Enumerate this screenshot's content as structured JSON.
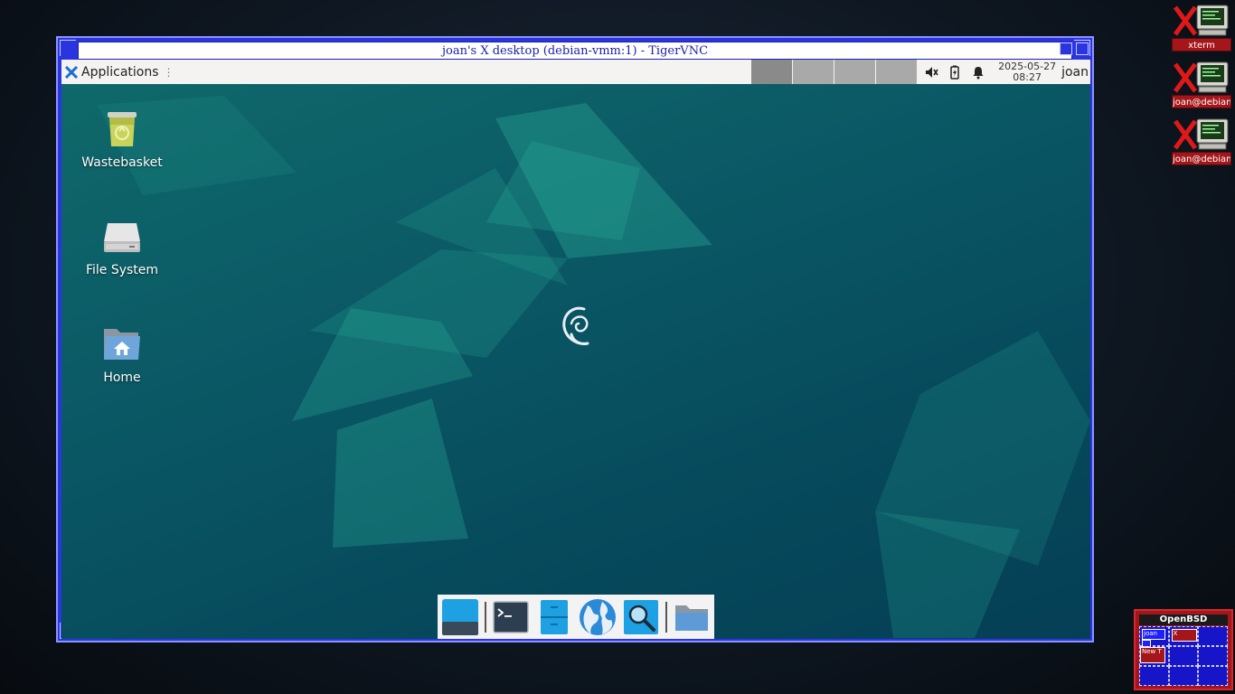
{
  "vnc_window": {
    "title": "joan's X desktop (debian-vmm:1) - TigerVNC"
  },
  "top_panel": {
    "applications_label": "Applications",
    "clock_date": "2025-05-27",
    "clock_time": "08:27",
    "user": "joan",
    "workspace_count": 4,
    "active_workspace": 1
  },
  "desktop_icons": [
    {
      "label": "Wastebasket",
      "icon": "trash-icon"
    },
    {
      "label": "File System",
      "icon": "drive-icon"
    },
    {
      "label": "Home",
      "icon": "home-folder-icon"
    }
  ],
  "dock_items": [
    {
      "name": "show-desktop",
      "icon": "show-desktop-icon"
    },
    {
      "name": "terminal",
      "icon": "terminal-icon"
    },
    {
      "name": "file-manager",
      "icon": "file-cabinet-icon"
    },
    {
      "name": "web-browser",
      "icon": "globe-icon"
    },
    {
      "name": "app-finder",
      "icon": "magnifier-icon"
    },
    {
      "name": "folder",
      "icon": "folder-icon"
    }
  ],
  "host_launchers": [
    {
      "label": "xterm"
    },
    {
      "label": "joan@debian"
    },
    {
      "label": "joan@debian"
    }
  ],
  "pager": {
    "title": "OpenBSD",
    "windows": [
      {
        "label": "joan"
      },
      {
        "label": "X"
      },
      {
        "label": "New T"
      }
    ]
  },
  "colors": {
    "host_frame": "#2a35e0",
    "panel_bg": "#f4f3f1",
    "launcher_label": "#a4161a",
    "pager_bg": "#1616c8"
  }
}
